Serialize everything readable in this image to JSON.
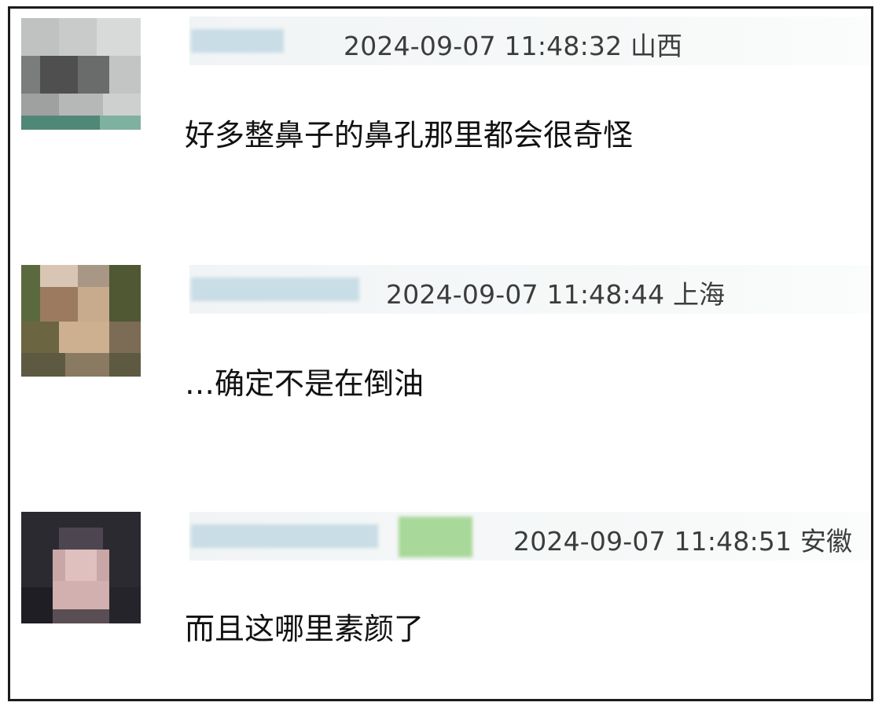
{
  "comments": [
    {
      "timestamp": "2024-09-07 11:48:32",
      "location": "山西",
      "text": "好多整鼻子的鼻孔那里都会很奇怪"
    },
    {
      "timestamp": "2024-09-07 11:48:44",
      "location": "上海",
      "text": "…确定不是在倒油"
    },
    {
      "timestamp": "2024-09-07 11:48:51",
      "location": "安徽",
      "text": "而且这哪里素颜了"
    }
  ],
  "colors": {
    "frame_border": "#1c1c1c",
    "meta_text": "#3c3c3c",
    "comment_text": "#111111",
    "blurred_name": "#c8dde6",
    "blurred_badge": "#a9d99a"
  },
  "icons": [
    "avatar-1-pixelated",
    "avatar-2-pixelated",
    "avatar-3-pixelated"
  ]
}
